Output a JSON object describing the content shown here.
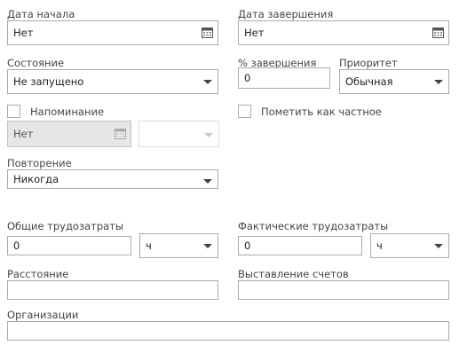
{
  "start_date": {
    "label": "Дата начала",
    "value": "Нет"
  },
  "end_date": {
    "label": "Дата завершения",
    "value": "Нет"
  },
  "status": {
    "label": "Состояние",
    "value": "Не запущено"
  },
  "percent_complete": {
    "label": "% завершения",
    "value": "0"
  },
  "priority": {
    "label": "Приоритет",
    "value": "Обычная"
  },
  "reminder": {
    "label": "Напоминание",
    "date": "Нет",
    "time": ""
  },
  "private": {
    "label": "Пометить как частное"
  },
  "recurrence": {
    "label": "Повторение",
    "value": "Никогда"
  },
  "total_work": {
    "label": "Общие трудозатраты",
    "value": "0",
    "unit": "ч"
  },
  "actual_work": {
    "label": "Фактические трудозатраты",
    "value": "0",
    "unit": "ч"
  },
  "mileage": {
    "label": "Расстояние",
    "value": ""
  },
  "billing": {
    "label": "Выставление счетов",
    "value": ""
  },
  "companies": {
    "label": "Организации",
    "value": ""
  },
  "icons": {
    "calendar": "calendar-icon",
    "dropdown": "chevron-down-icon"
  }
}
